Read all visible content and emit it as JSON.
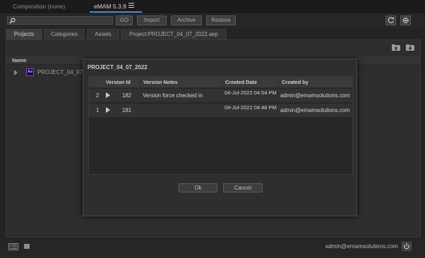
{
  "topbar": {
    "composition_tab": "Composition (none)",
    "app_tab": "eMAM 5.3.9"
  },
  "toolbar": {
    "search_placeholder": "",
    "go_label": "GO",
    "import_label": "Import",
    "archive_label": "Archive",
    "restore_label": "Restore"
  },
  "tabs": [
    {
      "label": "Projects",
      "active": true
    },
    {
      "label": "Categories",
      "active": false
    },
    {
      "label": "Assets",
      "active": false
    },
    {
      "label": "Project:PROJECT_04_07_2022.aep",
      "active": false
    }
  ],
  "panel": {
    "column_header": "Name",
    "project_row": {
      "icon_text": "Ae",
      "name": "PROJECT_04_07_..."
    }
  },
  "modal": {
    "title": "PROJECT_04_07_2022",
    "columns": [
      "Version Id",
      "Version Notes",
      "Created Date",
      "Created by"
    ],
    "rows": [
      {
        "index": "2",
        "version_id": "182",
        "notes": "Version force checked in",
        "created_date": "04-Jul-2022 04:54 PM",
        "created_by": "admin@emamsolutions.com"
      },
      {
        "index": "1",
        "version_id": "181",
        "notes": "",
        "created_date": "04-Jul-2022 04:48 PM",
        "created_by": "admin@emamsolutions.com"
      }
    ],
    "ok_label": "Ok",
    "cancel_label": "Cancel"
  },
  "status": {
    "user": "admin@emamsolutions.com"
  },
  "colors": {
    "accent": "#4a8ad0",
    "background": "#232323",
    "panel": "#2d2d2d",
    "ae_purple": "#7b4fc4"
  }
}
